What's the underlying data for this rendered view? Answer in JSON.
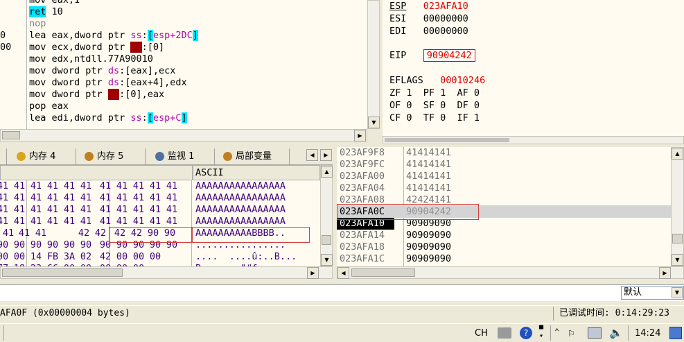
{
  "disasm": {
    "left_addr": [
      "0",
      "00"
    ],
    "lines": [
      {
        "op": "mov",
        "args": "eax,1"
      },
      {
        "op": "ret",
        "args": "10"
      },
      {
        "op": "nop",
        "args": ""
      },
      {
        "op": "lea",
        "p1": "eax,dword ptr ",
        "seg": "ss",
        "p2": ":",
        "bl": "[",
        "mem": "esp+2DC",
        "br": "]"
      },
      {
        "op": "mov",
        "p1": "ecx,dword ptr ",
        "seg": "fs",
        "p2": ":[0]"
      },
      {
        "op": "mov",
        "args": "edx,ntdll.77A90010"
      },
      {
        "op": "mov",
        "p1": "dword ptr ",
        "seg": "ds",
        "p2": ":[eax],ecx"
      },
      {
        "op": "mov",
        "p1": "dword ptr ",
        "seg": "ds",
        "p2": ":[eax+4],edx"
      },
      {
        "op": "mov",
        "p1": "dword ptr ",
        "seg": "fs",
        "p2": ":[0],eax"
      },
      {
        "op": "pop",
        "args": "eax"
      },
      {
        "op": "lea",
        "p1": "edi,dword ptr ",
        "seg": "ss",
        "p2": ":",
        "bl": "[",
        "mem": "esp+C",
        "br": "]"
      }
    ]
  },
  "registers": {
    "esp": {
      "name": "ESP",
      "value": "023AFA10"
    },
    "esi": {
      "name": "ESI",
      "value": "00000000"
    },
    "edi": {
      "name": "EDI",
      "value": "00000000"
    },
    "eip": {
      "name": "EIP",
      "value": "90904242"
    },
    "eflags": {
      "name": "EFLAGS",
      "value": "00010246"
    },
    "flags_rows": [
      "ZF 1  PF 1  AF 0",
      "OF 0  SF 0  DF 0",
      "CF 0  TF 0  IF 1"
    ]
  },
  "tabs": [
    {
      "label": "内存 4"
    },
    {
      "label": "内存 5"
    },
    {
      "label": "监视 1"
    },
    {
      "label": "局部变量"
    }
  ],
  "dump": {
    "ascii_header": "ASCII",
    "rows": [
      {
        "bytes": [
          "41",
          "41",
          "41",
          "41",
          "41",
          "41",
          "41",
          "41",
          "41",
          "41",
          "41"
        ],
        "ascii": "AAAAAAAAAAAAAAAA"
      },
      {
        "bytes": [
          "41",
          "41",
          "41",
          "41",
          "41",
          "41",
          "41",
          "41",
          "41",
          "41",
          "41"
        ],
        "ascii": "AAAAAAAAAAAAAAAA"
      },
      {
        "bytes": [
          "41",
          "41",
          "41",
          "41",
          "41",
          "41",
          "41",
          "41",
          "41",
          "41",
          "41"
        ],
        "ascii": "AAAAAAAAAAAAAAAA"
      },
      {
        "bytes": [
          "41",
          "41",
          "41",
          "41",
          "41",
          "41",
          "41",
          "41",
          "41",
          "41",
          "41"
        ],
        "ascii": "AAAAAAAAAAAAAAAA"
      },
      {
        "bytes": [
          "41",
          "41",
          "41",
          "42",
          "42",
          "42",
          "42",
          "90",
          "90"
        ],
        "ascii": "AAAAAAAAAABBBB.."
      },
      {
        "bytes": [
          "90",
          "90",
          "90",
          "90",
          "90",
          "90",
          "90",
          "90",
          "90",
          "90",
          "90"
        ],
        "ascii": "................"
      },
      {
        "bytes": [
          "00",
          "00",
          "14",
          "FB",
          "3A",
          "02",
          "42",
          "00",
          "00",
          "00"
        ],
        "ascii": "....  ....û:..B..."
      },
      {
        "bytes": [
          "77",
          "18",
          "23",
          "66",
          "00",
          "00",
          "00",
          "00",
          "00"
        ],
        "ascii": "B.......\"#f"
      }
    ]
  },
  "stack": {
    "rows": [
      {
        "addr": "023AF9F8",
        "val": "41414141"
      },
      {
        "addr": "023AF9FC",
        "val": "41414141"
      },
      {
        "addr": "023AFA00",
        "val": "41414141"
      },
      {
        "addr": "023AFA04",
        "val": "41414141"
      },
      {
        "addr": "023AFA08",
        "val": "42424141"
      },
      {
        "addr": "023AFA0C",
        "val": "90904242"
      },
      {
        "addr": "023AFA10",
        "val": "90909090"
      },
      {
        "addr": "023AFA14",
        "val": "90909090"
      },
      {
        "addr": "023AFA18",
        "val": "90909090"
      },
      {
        "addr": "023AFA1C",
        "val": "90909090"
      },
      {
        "addr": "023AFA20",
        "val": "90909090"
      }
    ]
  },
  "cmd": {
    "dropdown": "默认"
  },
  "status": {
    "left": "AFA0F (0x00000004 bytes)",
    "right": "已调试时间: 0:14:29:23"
  },
  "taskbar": {
    "lang": "CH",
    "time": "14:24"
  },
  "colors": {
    "pane_bg": "#fffbf0",
    "highlight_red": "#e00000",
    "cyan": "#00e5ff",
    "selection_gray": "#d0d0d0"
  }
}
